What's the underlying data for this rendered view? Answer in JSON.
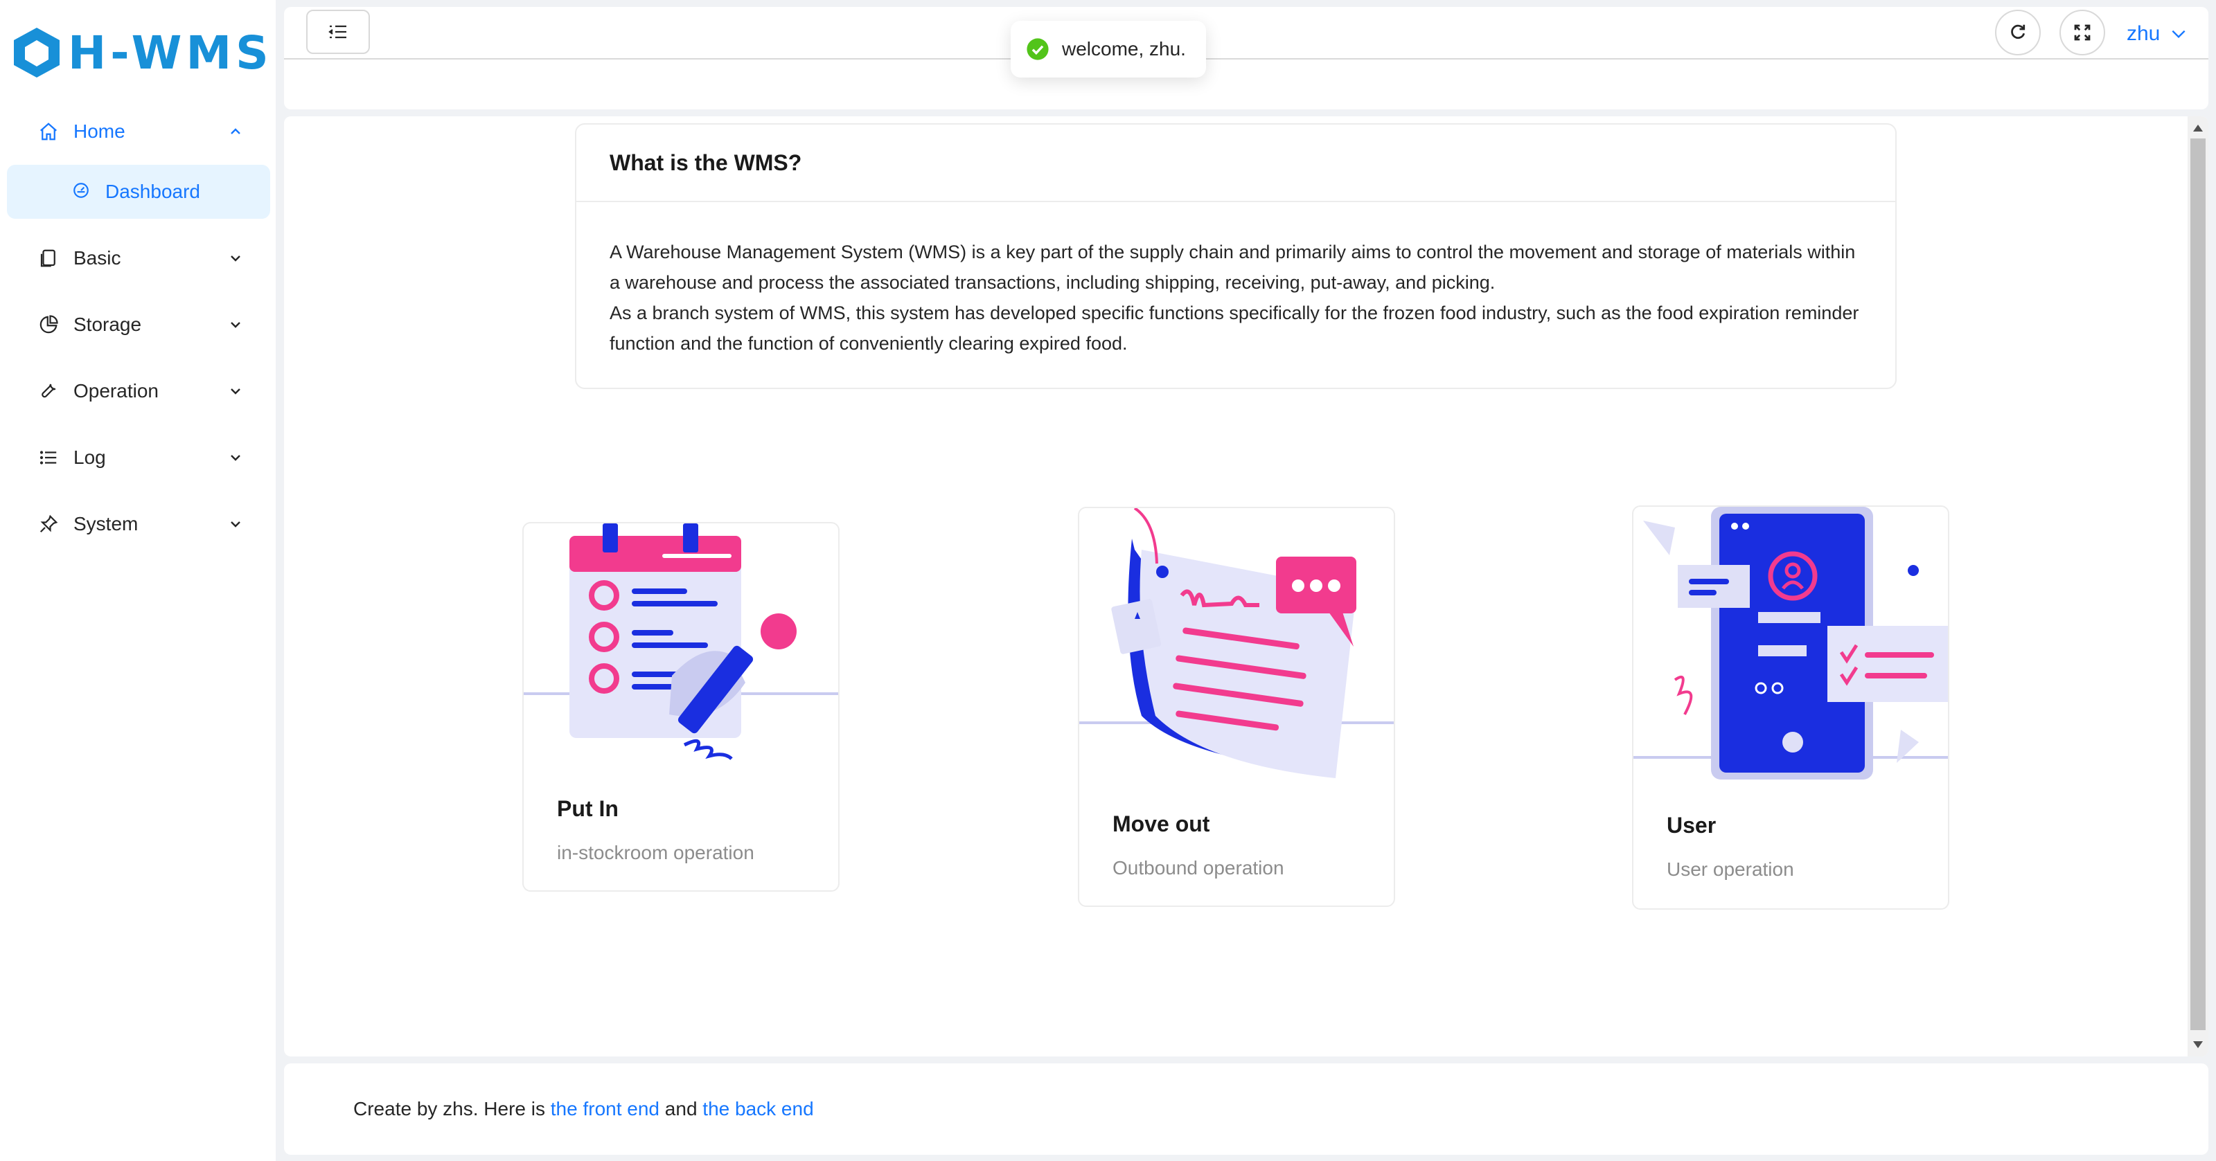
{
  "app": {
    "logo_text": "H-WMS",
    "brand_color": "#1890d8",
    "accent_color": "#1677ff"
  },
  "sidebar": {
    "items": [
      {
        "label": "Home",
        "icon": "home-icon",
        "expanded": true
      },
      {
        "label": "Dashboard",
        "icon": "dashboard-icon",
        "selected": true
      },
      {
        "label": "Basic",
        "icon": "copy-icon"
      },
      {
        "label": "Storage",
        "icon": "pie-chart-icon"
      },
      {
        "label": "Operation",
        "icon": "wrench-icon"
      },
      {
        "label": "Log",
        "icon": "list-icon"
      },
      {
        "label": "System",
        "icon": "pin-icon"
      }
    ]
  },
  "header": {
    "user": "zhu"
  },
  "toast": {
    "message": "welcome, zhu."
  },
  "info": {
    "title": "What is the WMS?",
    "paragraph1": "A Warehouse Management System (WMS) is a key part of the supply chain and primarily aims to control the movement and storage of materials within a warehouse and process the associated transactions, including shipping, receiving, put-away, and picking.",
    "paragraph2": "As a branch system of WMS, this system has developed specific functions specifically for the frozen food industry, such as the food expiration reminder function and the function of conveniently clearing expired food."
  },
  "cards": [
    {
      "title": "Put In",
      "desc": "in-stockroom operation"
    },
    {
      "title": "Move out",
      "desc": "Outbound operation"
    },
    {
      "title": "User",
      "desc": "User operation"
    }
  ],
  "footer": {
    "prefix": "Create by zhs. Here is ",
    "link1": "the front end",
    "middle": " and ",
    "link2": "the back end"
  }
}
